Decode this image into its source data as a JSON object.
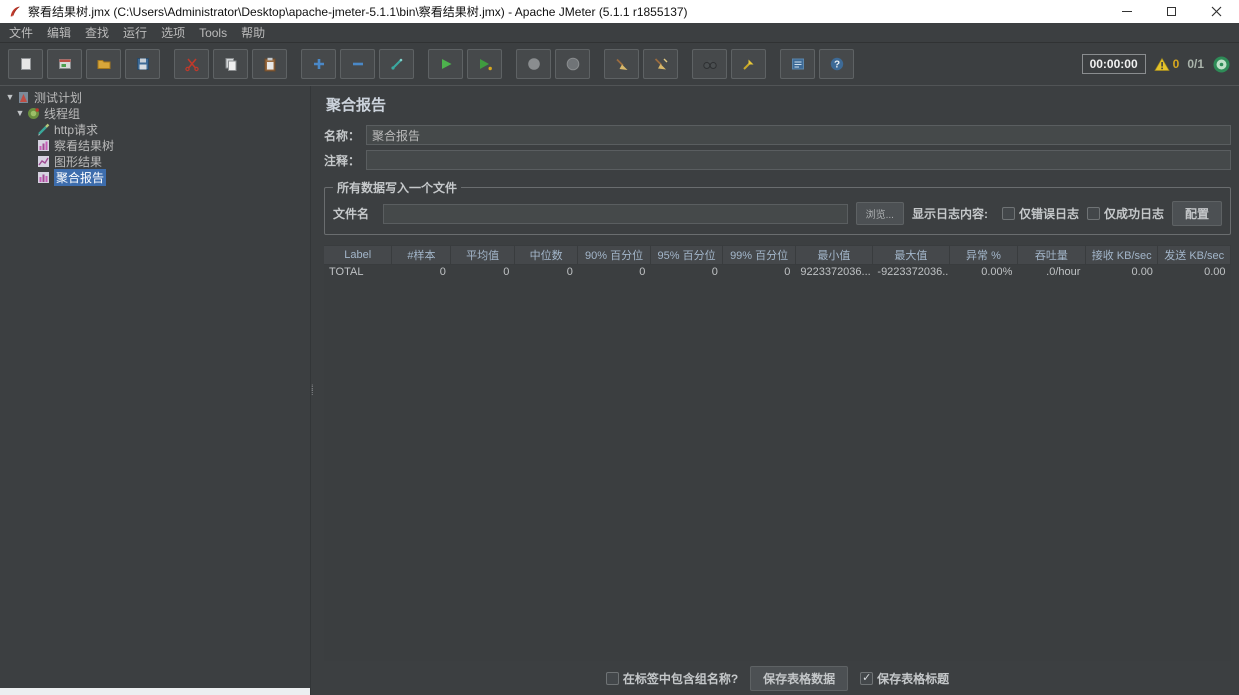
{
  "window": {
    "title": "察看结果树.jmx (C:\\Users\\Administrator\\Desktop\\apache-jmeter-5.1.1\\bin\\察看结果树.jmx) - Apache JMeter (5.1.1 r1855137)"
  },
  "menu": {
    "items": [
      "文件",
      "编辑",
      "查找",
      "运行",
      "选项",
      "Tools",
      "帮助"
    ]
  },
  "toolbar": {
    "timer": "00:00:00",
    "warning_count": "0",
    "thread_count": "0/1"
  },
  "tree": {
    "items": [
      {
        "label": "测试计划",
        "selected": false
      },
      {
        "label": "线程组",
        "selected": false
      },
      {
        "label": "http请求",
        "selected": false
      },
      {
        "label": "察看结果树",
        "selected": false
      },
      {
        "label": "图形结果",
        "selected": false
      },
      {
        "label": "聚合报告",
        "selected": true
      }
    ]
  },
  "main": {
    "title": "聚合报告",
    "name_label": "名称：",
    "name_value": "聚合报告",
    "comment_label": "注释：",
    "comment_value": "",
    "file_group": {
      "title": "所有数据写入一个文件",
      "filename_label": "文件名",
      "filename_value": "",
      "browse_button": "浏览...",
      "log_display_label": "显示日志内容:",
      "errors_checkbox": "仅错误日志",
      "errors_checked": false,
      "success_checkbox": "仅成功日志",
      "success_checked": false,
      "configure_button": "配置"
    },
    "table": {
      "columns": [
        "Label",
        "#样本",
        "平均值",
        "中位数",
        "90% 百分位",
        "95% 百分位",
        "99% 百分位",
        "最小值",
        "最大值",
        "异常 %",
        "吞吐量",
        "接收 KB/sec",
        "发送 KB/sec"
      ],
      "rows": [
        [
          "TOTAL",
          "0",
          "0",
          "0",
          "0",
          "0",
          "0",
          "9223372036...",
          "-9223372036...",
          "0.00%",
          ".0/hour",
          "0.00",
          "0.00"
        ]
      ]
    },
    "footer": {
      "include_group_label": "在标签中包含组名称?",
      "include_group_checked": false,
      "save_table_button": "保存表格数据",
      "save_header_label": "保存表格标题",
      "save_header_checked": true
    }
  }
}
